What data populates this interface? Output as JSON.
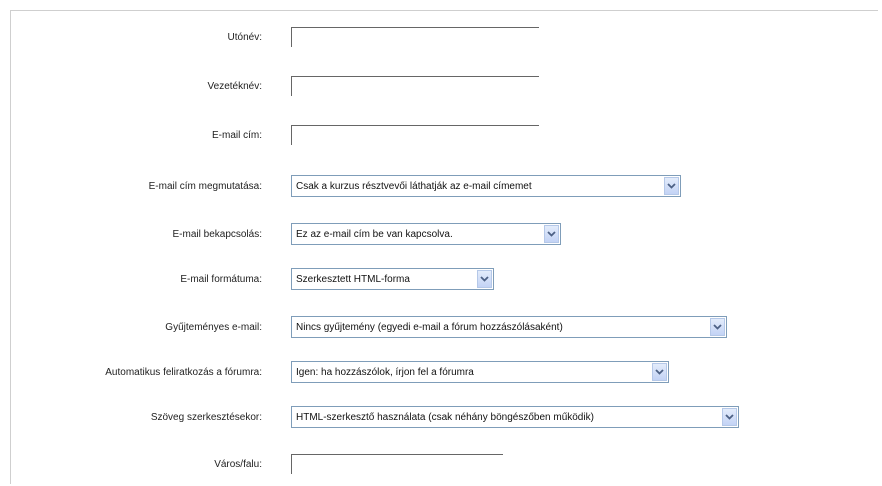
{
  "form": {
    "fields": [
      {
        "label": "Utónév:",
        "type": "text",
        "value": ""
      },
      {
        "label": "Vezetéknév:",
        "type": "text",
        "value": ""
      },
      {
        "label": "E-mail cím:",
        "type": "text",
        "value": ""
      },
      {
        "label": "E-mail cím megmutatása:",
        "type": "select",
        "value": "Csak a kurzus résztvevői láthatják az e-mail címemet"
      },
      {
        "label": "E-mail bekapcsolás:",
        "type": "select",
        "value": "Ez az e-mail cím be van kapcsolva."
      },
      {
        "label": "E-mail formátuma:",
        "type": "select",
        "value": "Szerkesztett HTML-forma"
      },
      {
        "label": "Gyűjteményes e-mail:",
        "type": "select",
        "value": "Nincs gyűjtemény (egyedi e-mail a fórum hozzászólásaként)"
      },
      {
        "label": "Automatikus feliratkozás a fórumra:",
        "type": "select",
        "value": "Igen: ha hozzászólok, írjon fel a fórumra"
      },
      {
        "label": "Szöveg szerkesztésekor:",
        "type": "select",
        "value": "HTML-szerkesztő használata (csak néhány böngészőben működik)"
      },
      {
        "label": "Város/falu:",
        "type": "text",
        "value": ""
      }
    ]
  },
  "icons": {
    "select_arrow": "chevron-down-icon"
  },
  "colors": {
    "select_border": "#7f9db9",
    "arrow_button": "#c3d3f5",
    "arrow_glyph": "#4d6185"
  }
}
